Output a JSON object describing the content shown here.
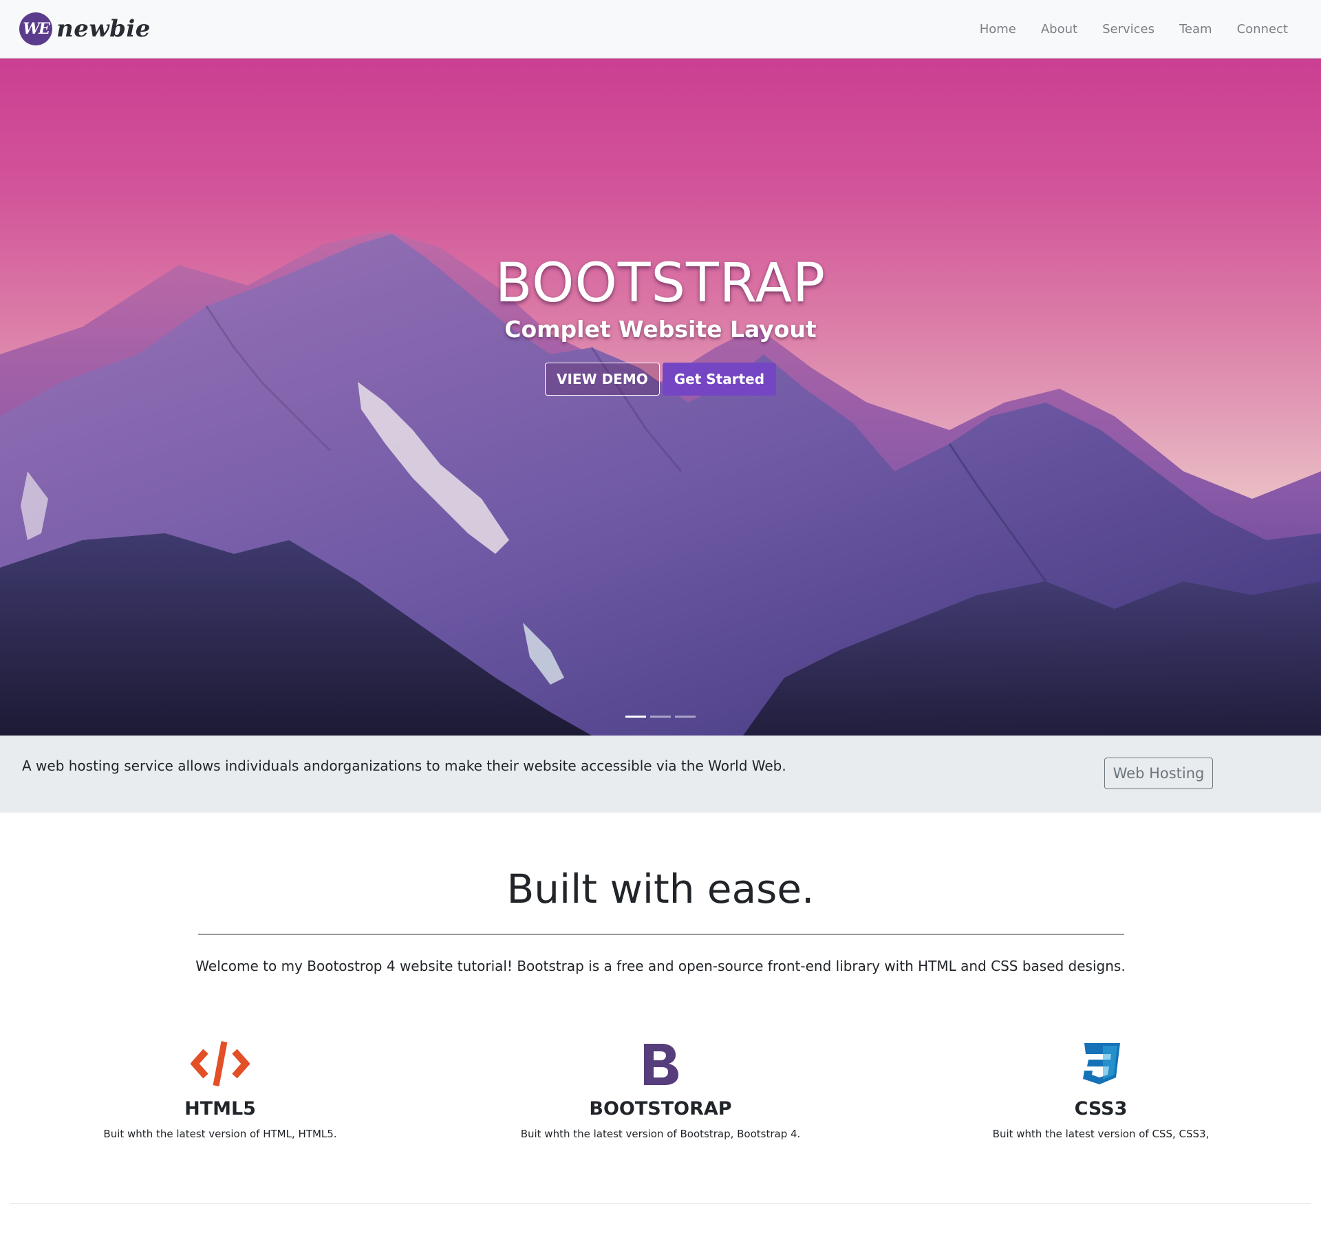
{
  "navbar": {
    "brand_badge": "WE",
    "brand_word": "newbie",
    "links": [
      {
        "label": "Home"
      },
      {
        "label": "About"
      },
      {
        "label": "Services"
      },
      {
        "label": "Team"
      },
      {
        "label": "Connect"
      }
    ]
  },
  "hero": {
    "title": "BOOTSTRAP",
    "subtitle": "Complet Website Layout",
    "btn_demo": "VIEW DEMO",
    "btn_start": "Get Started",
    "slides": 3,
    "active_slide": 1
  },
  "jumbotron": {
    "text": "A web hosting service allows individuals andorganizations to make their website accessible via the World Web.",
    "button": "Web Hosting"
  },
  "welcome": {
    "heading": "Built with ease.",
    "lead": "Welcome to my Bootostrop 4 website tutorial! Bootstrap is a free and open-source front-end library with HTML and CSS based designs."
  },
  "features": [
    {
      "icon": "code-icon",
      "title": "HTML5",
      "text": "Buit whth the latest version of HTML, HTML5."
    },
    {
      "icon": "bootstrap-icon",
      "title": "BOOTSTORAP",
      "text": "Buit whth the latest version of Bootstrap, Bootstrap 4."
    },
    {
      "icon": "css3-icon",
      "title": "CSS3",
      "text": "Buit whth the latest version of CSS, CSS3,"
    }
  ],
  "colors": {
    "brand_purple": "#5b3c8c",
    "primary_button": "#7446c4",
    "html5_orange": "#e34f26",
    "bootstrap_purple": "#563d7c",
    "css3_blue": "#1572b6"
  }
}
